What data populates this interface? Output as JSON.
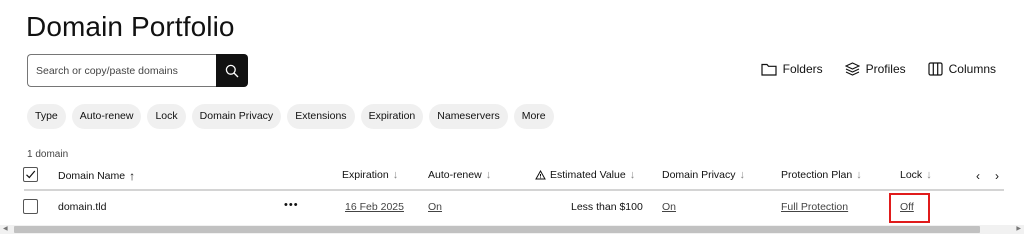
{
  "page": {
    "title": "Domain Portfolio"
  },
  "search": {
    "placeholder": "Search or copy/paste domains",
    "icon": "search-icon"
  },
  "toolbar": {
    "folders_label": "Folders",
    "profiles_label": "Profiles",
    "columns_label": "Columns"
  },
  "filters": [
    {
      "label": "Type"
    },
    {
      "label": "Auto-renew"
    },
    {
      "label": "Lock"
    },
    {
      "label": "Domain Privacy"
    },
    {
      "label": "Extensions"
    },
    {
      "label": "Expiration"
    },
    {
      "label": "Nameservers"
    },
    {
      "label": "More"
    }
  ],
  "table": {
    "count_text": "1 domain",
    "columns": {
      "domain_name": "Domain Name",
      "expiration": "Expiration",
      "auto_renew": "Auto-renew",
      "estimated_value": "Estimated Value",
      "domain_privacy": "Domain Privacy",
      "protection_plan": "Protection Plan",
      "lock": "Lock"
    },
    "rows": [
      {
        "domain": "domain.tld",
        "more": "•••",
        "expiration": "16 Feb 2025",
        "auto_renew": "On",
        "estimated_value": "Less than $100",
        "domain_privacy": "On",
        "protection_plan": "Full Protection",
        "lock": "Off"
      }
    ]
  },
  "colors": {
    "highlight": "#e01b1b",
    "button_bg": "#111111",
    "chip_bg": "#f0f0f0"
  }
}
